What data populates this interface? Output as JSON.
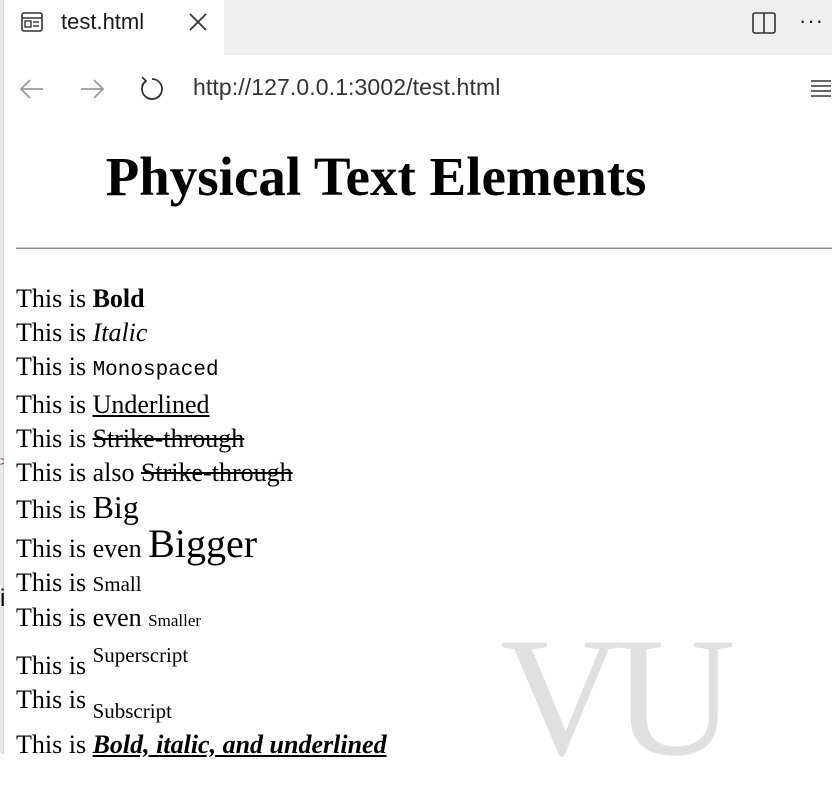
{
  "browser": {
    "tab_title": "test.html",
    "url": "http://127.0.0.1:3002/test.html",
    "icons": {
      "tab": "page-icon",
      "close": "close-icon",
      "split": "split-screen-icon",
      "more": "more-icon",
      "back": "back-arrow-icon",
      "forward": "forward-arrow-icon",
      "refresh": "refresh-icon",
      "menu": "reader-menu-icon"
    },
    "more_label": "···"
  },
  "page": {
    "title": "Physical Text Elements",
    "lines": [
      {
        "prefix": "This is ",
        "text": "Bold"
      },
      {
        "prefix": "This is ",
        "text": "Italic"
      },
      {
        "prefix": "This is ",
        "text": "Monospaced"
      },
      {
        "prefix": "This is ",
        "text": "Underlined"
      },
      {
        "prefix": "This is ",
        "text": "Strike-through"
      },
      {
        "prefix": "This is also ",
        "text": "Strike-through"
      },
      {
        "prefix": "This is ",
        "text": "Big"
      },
      {
        "prefix": "This is even ",
        "text": "Bigger"
      },
      {
        "prefix": "This is ",
        "text": "Small"
      },
      {
        "prefix": "This is even ",
        "text": "Smaller"
      },
      {
        "prefix": "This is ",
        "text": "Superscript"
      },
      {
        "prefix": "This is ",
        "text": "Subscript"
      },
      {
        "prefix": "This is ",
        "text": "Bold, italic, and underlined"
      }
    ]
  },
  "colors": {
    "tabbar_bg": "#efefef",
    "page_bg": "#ffffff",
    "text": "#000000"
  }
}
